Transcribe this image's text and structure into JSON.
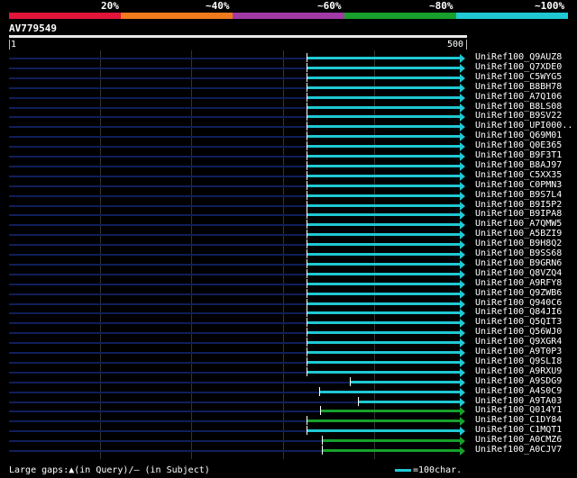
{
  "percent_labels": [
    "20%",
    "~40%",
    "~60%",
    "~80%",
    "~100%"
  ],
  "identity_colors": [
    "#e2143a",
    "#f07a1c",
    "#a23aa6",
    "#17a02b",
    "#1fc8d3"
  ],
  "query": {
    "name": "AV779549",
    "scale_start": "1",
    "scale_end": "500"
  },
  "footer": {
    "gaps_note": "Large gaps:▲(in Query)/– (in Subject)",
    "legend_label": "=100char."
  },
  "hits": [
    {
      "label": "UniRef100_Q9AUZ8",
      "start": 330,
      "end": 500,
      "color": "#1fc8d3"
    },
    {
      "label": "UniRef100_Q7XDE0",
      "start": 330,
      "end": 500,
      "color": "#1fc8d3"
    },
    {
      "label": "UniRef100_C5WYG5",
      "start": 330,
      "end": 500,
      "color": "#1fc8d3"
    },
    {
      "label": "UniRef100_B8BH78",
      "start": 330,
      "end": 500,
      "color": "#1fc8d3"
    },
    {
      "label": "UniRef100_A7Q106",
      "start": 330,
      "end": 500,
      "color": "#1fc8d3"
    },
    {
      "label": "UniRef100_B8LS08",
      "start": 330,
      "end": 500,
      "color": "#1fc8d3"
    },
    {
      "label": "UniRef100_B9SV22",
      "start": 330,
      "end": 500,
      "color": "#1fc8d3"
    },
    {
      "label": "UniRef100_UPI000..",
      "start": 330,
      "end": 500,
      "color": "#1fc8d3"
    },
    {
      "label": "UniRef100_Q69M01",
      "start": 330,
      "end": 500,
      "color": "#1fc8d3"
    },
    {
      "label": "UniRef100_Q0E365",
      "start": 330,
      "end": 500,
      "color": "#1fc8d3"
    },
    {
      "label": "UniRef100_B9F3T1",
      "start": 330,
      "end": 500,
      "color": "#1fc8d3"
    },
    {
      "label": "UniRef100_B8AJ97",
      "start": 330,
      "end": 500,
      "color": "#1fc8d3"
    },
    {
      "label": "UniRef100_C5XX35",
      "start": 330,
      "end": 500,
      "color": "#1fc8d3"
    },
    {
      "label": "UniRef100_C0PMN3",
      "start": 330,
      "end": 500,
      "color": "#1fc8d3"
    },
    {
      "label": "UniRef100_B9S7L4",
      "start": 330,
      "end": 500,
      "color": "#1fc8d3"
    },
    {
      "label": "UniRef100_B9I5P2",
      "start": 330,
      "end": 500,
      "color": "#1fc8d3"
    },
    {
      "label": "UniRef100_B9IPA8",
      "start": 330,
      "end": 500,
      "color": "#1fc8d3"
    },
    {
      "label": "UniRef100_A7QMW5",
      "start": 330,
      "end": 500,
      "color": "#1fc8d3"
    },
    {
      "label": "UniRef100_A5BZI9",
      "start": 330,
      "end": 500,
      "color": "#1fc8d3"
    },
    {
      "label": "UniRef100_B9H8Q2",
      "start": 330,
      "end": 500,
      "color": "#1fc8d3"
    },
    {
      "label": "UniRef100_B9SS68",
      "start": 330,
      "end": 500,
      "color": "#1fc8d3"
    },
    {
      "label": "UniRef100_B9GRN6",
      "start": 330,
      "end": 500,
      "color": "#1fc8d3"
    },
    {
      "label": "UniRef100_Q8VZQ4",
      "start": 330,
      "end": 500,
      "color": "#1fc8d3"
    },
    {
      "label": "UniRef100_A9RFY8",
      "start": 330,
      "end": 500,
      "color": "#1fc8d3"
    },
    {
      "label": "UniRef100_Q9ZWB6",
      "start": 330,
      "end": 500,
      "color": "#1fc8d3"
    },
    {
      "label": "UniRef100_Q940C6",
      "start": 330,
      "end": 500,
      "color": "#1fc8d3"
    },
    {
      "label": "UniRef100_Q84JI6",
      "start": 330,
      "end": 500,
      "color": "#1fc8d3"
    },
    {
      "label": "UniRef100_Q5QIT3",
      "start": 330,
      "end": 500,
      "color": "#1fc8d3"
    },
    {
      "label": "UniRef100_Q56WJ0",
      "start": 330,
      "end": 500,
      "color": "#1fc8d3"
    },
    {
      "label": "UniRef100_Q9XGR4",
      "start": 330,
      "end": 500,
      "color": "#1fc8d3"
    },
    {
      "label": "UniRef100_A9T0P3",
      "start": 330,
      "end": 500,
      "color": "#1fc8d3"
    },
    {
      "label": "UniRef100_Q9SLI8",
      "start": 330,
      "end": 500,
      "color": "#1fc8d3"
    },
    {
      "label": "UniRef100_A9RXU9",
      "start": 330,
      "end": 500,
      "color": "#1fc8d3"
    },
    {
      "label": "UniRef100_A9SDG9",
      "start": 378,
      "end": 500,
      "color": "#1fc8d3"
    },
    {
      "label": "UniRef100_A4S0C9",
      "start": 344,
      "end": 500,
      "color": "#1fc8d3"
    },
    {
      "label": "UniRef100_A9TA03",
      "start": 387,
      "end": 500,
      "color": "#1fc8d3"
    },
    {
      "label": "UniRef100_Q014Y1",
      "start": 345,
      "end": 500,
      "color": "#17a02b"
    },
    {
      "label": "UniRef100_C1DY84",
      "start": 330,
      "end": 500,
      "color": "#17a02b"
    },
    {
      "label": "UniRef100_C1MQT1",
      "start": 330,
      "end": 500,
      "color": "#1fc8d3"
    },
    {
      "label": "UniRef100_A0CMZ6",
      "start": 347,
      "end": 500,
      "color": "#17a02b"
    },
    {
      "label": "UniRef100_A0CJV7",
      "start": 347,
      "end": 500,
      "color": "#17a02b"
    }
  ]
}
